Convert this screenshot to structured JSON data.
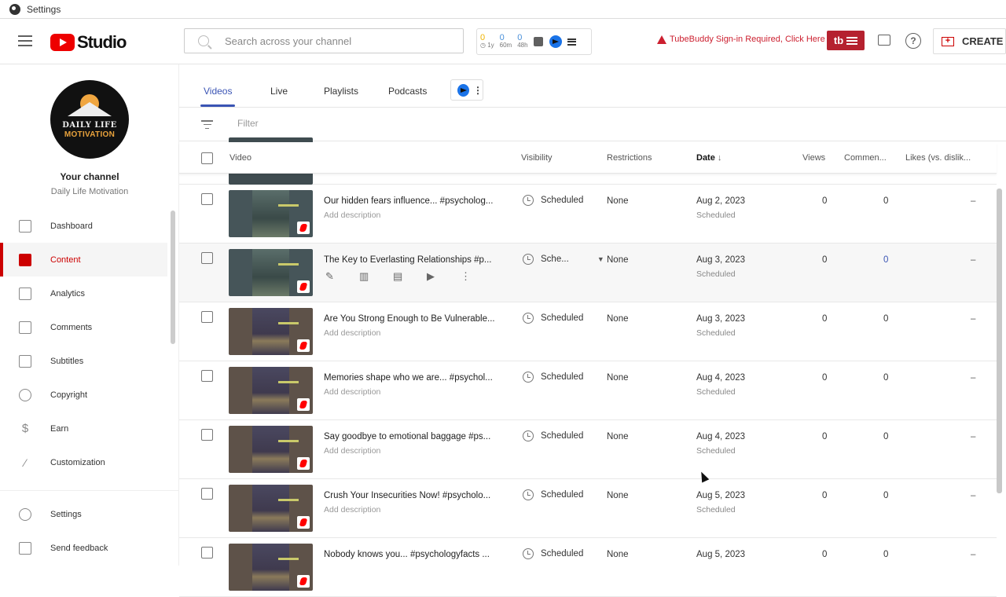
{
  "window": {
    "title": "Settings"
  },
  "header": {
    "logo_text": "Studio",
    "search_placeholder": "Search across your channel",
    "tubebuddy_stats": [
      {
        "value": "0",
        "label": "1y",
        "color": "#f0b400"
      },
      {
        "value": "0",
        "label": "60m",
        "color": "#4a90d9"
      },
      {
        "value": "0",
        "label": "48h",
        "color": "#4a90d9"
      }
    ],
    "tubebuddy_warning": "TubeBuddy Sign-in Required, Click Here",
    "tubebuddy_button": "tb",
    "create_label": "CREATE"
  },
  "sidebar": {
    "avatar_line1": "DAILY LIFE",
    "avatar_line2": "MOTIVATION",
    "your_channel": "Your channel",
    "channel_name": "Daily Life Motivation",
    "items": [
      {
        "label": "Dashboard",
        "icon": "dashboard-icon",
        "active": false
      },
      {
        "label": "Content",
        "icon": "content-icon",
        "active": true
      },
      {
        "label": "Analytics",
        "icon": "analytics-icon",
        "active": false
      },
      {
        "label": "Comments",
        "icon": "comments-icon",
        "active": false
      },
      {
        "label": "Subtitles",
        "icon": "subtitles-icon",
        "active": false
      },
      {
        "label": "Copyright",
        "icon": "copyright-icon",
        "active": false
      },
      {
        "label": "Earn",
        "icon": "earn-icon",
        "active": false
      },
      {
        "label": "Customization",
        "icon": "customization-icon",
        "active": false
      }
    ],
    "bottom_items": [
      {
        "label": "Settings",
        "icon": "settings-icon"
      },
      {
        "label": "Send feedback",
        "icon": "feedback-icon"
      }
    ]
  },
  "main": {
    "tabs": [
      {
        "label": "Videos",
        "active": true
      },
      {
        "label": "Live",
        "active": false
      },
      {
        "label": "Playlists",
        "active": false
      },
      {
        "label": "Podcasts",
        "active": false
      }
    ],
    "filter_placeholder": "Filter",
    "columns": {
      "video": "Video",
      "visibility": "Visibility",
      "restrictions": "Restrictions",
      "date": "Date",
      "date_sort": "↓",
      "views": "Views",
      "comments": "Commen...",
      "likes": "Likes (vs. dislik..."
    },
    "rows": [
      {
        "title": "Our hidden fears influence... #psycholog...",
        "description": "Add description",
        "visibility": "Scheduled",
        "restrictions": "None",
        "date": "Aug 2, 2023",
        "date_status": "Scheduled",
        "views": "0",
        "comments": "0",
        "likes": "–",
        "thumb_theme": "teal",
        "hover": false
      },
      {
        "title": "The Key to Everlasting Relationships #p...",
        "description": "",
        "visibility": "Sche...",
        "restrictions": "None",
        "date": "Aug 3, 2023",
        "date_status": "Scheduled",
        "views": "0",
        "comments": "0",
        "likes": "–",
        "thumb_theme": "teal",
        "hover": true
      },
      {
        "title": "Are You Strong Enough to Be Vulnerable...",
        "description": "Add description",
        "visibility": "Scheduled",
        "restrictions": "None",
        "date": "Aug 3, 2023",
        "date_status": "Scheduled",
        "views": "0",
        "comments": "0",
        "likes": "–",
        "thumb_theme": "brown",
        "hover": false
      },
      {
        "title": "Memories shape who we are... #psychol...",
        "description": "Add description",
        "visibility": "Scheduled",
        "restrictions": "None",
        "date": "Aug 4, 2023",
        "date_status": "Scheduled",
        "views": "0",
        "comments": "0",
        "likes": "–",
        "thumb_theme": "brown",
        "hover": false
      },
      {
        "title": "Say goodbye to emotional baggage #ps...",
        "description": "Add description",
        "visibility": "Scheduled",
        "restrictions": "None",
        "date": "Aug 4, 2023",
        "date_status": "Scheduled",
        "views": "0",
        "comments": "0",
        "likes": "–",
        "thumb_theme": "brown",
        "hover": false
      },
      {
        "title": "Crush Your Insecurities Now! #psycholo...",
        "description": "Add description",
        "visibility": "Scheduled",
        "restrictions": "None",
        "date": "Aug 5, 2023",
        "date_status": "Scheduled",
        "views": "0",
        "comments": "0",
        "likes": "–",
        "thumb_theme": "brown",
        "hover": false
      },
      {
        "title": "Nobody knows you... #psychologyfacts ...",
        "description": "",
        "visibility": "Scheduled",
        "restrictions": "None",
        "date": "Aug 5, 2023",
        "date_status": "",
        "views": "0",
        "comments": "0",
        "likes": "–",
        "thumb_theme": "brown",
        "hover": false
      }
    ],
    "hover_actions": [
      "edit-icon",
      "analytics-icon",
      "comments-icon",
      "youtube-icon",
      "more-options-icon"
    ]
  },
  "colors": {
    "accent": "#cc0000",
    "tab_active": "#3a54b4",
    "tubebuddy": "#b5212f"
  }
}
